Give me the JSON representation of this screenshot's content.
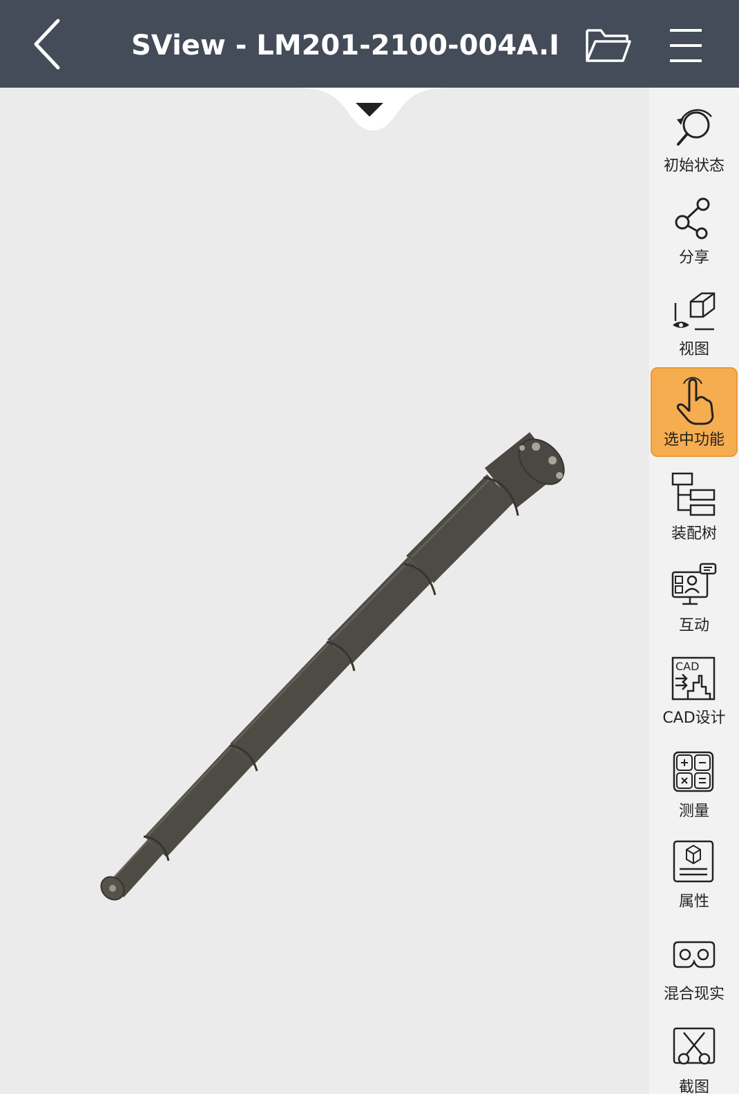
{
  "header": {
    "title": "SView - LM201-2100-004A.I. .",
    "back_icon": "chevron-left-icon",
    "folder_icon": "folder-open-icon",
    "menu_icon": "hamburger-menu-icon"
  },
  "viewport": {
    "pull_tab_icon": "caret-down-icon"
  },
  "sidebar": {
    "items": [
      {
        "label": "初始状态",
        "icon": "reset-view-icon",
        "active": false
      },
      {
        "label": "分享",
        "icon": "share-icon",
        "active": false
      },
      {
        "label": "视图",
        "icon": "view-cube-icon",
        "active": false
      },
      {
        "label": "选中功能",
        "icon": "hand-pointer-icon",
        "active": true
      },
      {
        "label": "装配树",
        "icon": "assembly-tree-icon",
        "active": false
      },
      {
        "label": "互动",
        "icon": "interaction-icon",
        "active": false
      },
      {
        "label": "CAD设计",
        "icon": "cad-design-icon",
        "active": false
      },
      {
        "label": "测量",
        "icon": "measure-icon",
        "active": false
      },
      {
        "label": "属性",
        "icon": "properties-icon",
        "active": false
      },
      {
        "label": "混合现实",
        "icon": "mixed-reality-icon",
        "active": false
      },
      {
        "label": "截图",
        "icon": "screenshot-icon",
        "active": false
      }
    ],
    "cad_icon_text": "CAD"
  },
  "colors": {
    "header_bg": "#434c58",
    "viewport_bg": "#ebebeb",
    "sidebar_bg": "#f2f2f2",
    "active_bg": "#f6ad4f",
    "model_color": "#4e4b45"
  }
}
